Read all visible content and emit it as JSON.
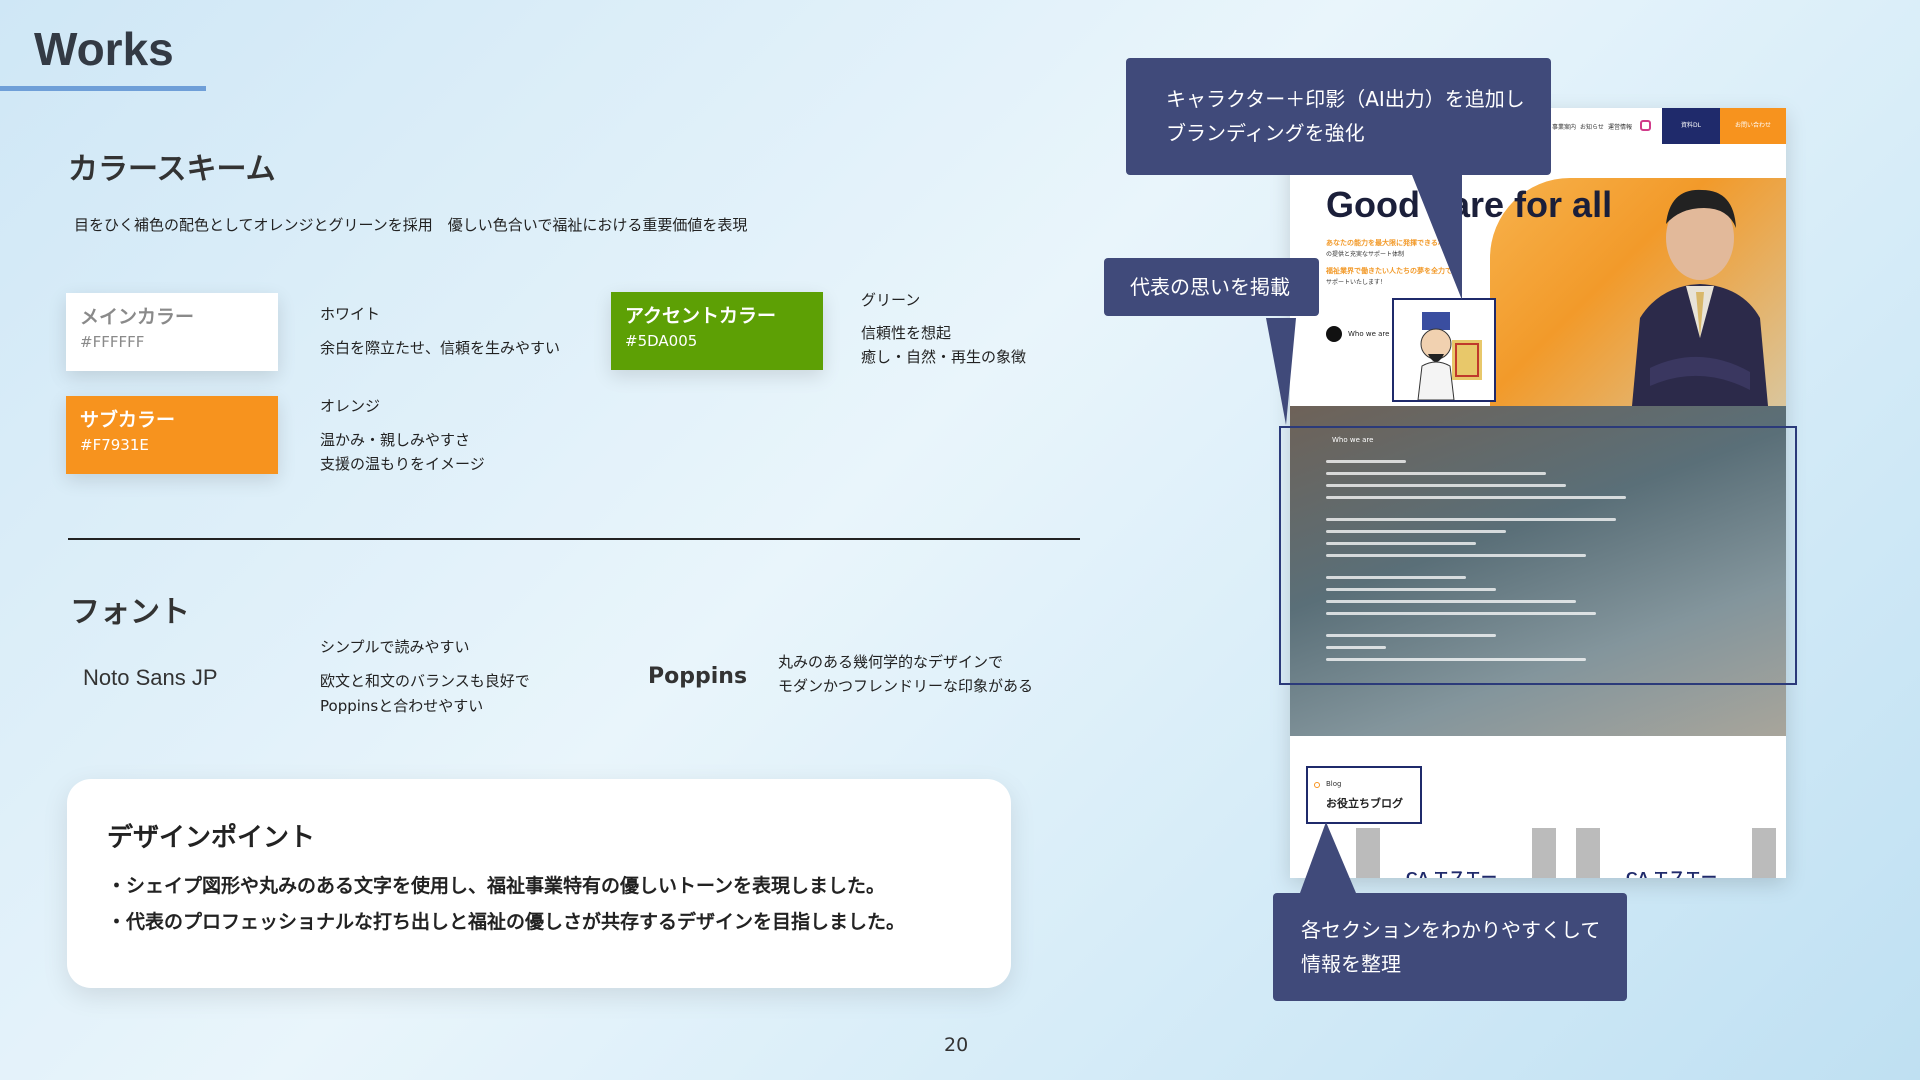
{
  "page": {
    "title": "Works",
    "page_number": "20"
  },
  "color_scheme": {
    "heading": "カラースキーム",
    "description": "目をひく補色の配色としてオレンジとグリーンを採用　優しい色合いで福祉における重要価値を表現",
    "main": {
      "name": "メインカラー",
      "hex": "#FFFFFF",
      "label": "ホワイト",
      "desc": "余白を際立たせ、信頼を生みやすい"
    },
    "sub": {
      "name": "サブカラー",
      "hex": "#F7931E",
      "label": "オレンジ",
      "desc1": "温かみ・親しみやすさ",
      "desc2": "支援の温もりをイメージ"
    },
    "accent": {
      "name": "アクセントカラー",
      "hex": "#5DA005",
      "label": "グリーン",
      "desc1": "信頼性を想起",
      "desc2": "癒し・自然・再生の象徴"
    }
  },
  "fonts": {
    "heading": "フォント",
    "noto": {
      "name": "Noto Sans JP",
      "desc1": "シンプルで読みやすい",
      "desc2": "欧文と和文のバランスも良好で",
      "desc3": "Poppinsと合わせやすい"
    },
    "poppins": {
      "name": "Poppins",
      "desc1": "丸みのある幾何学的なデザインで",
      "desc2": "モダンかつフレンドリーな印象がある"
    }
  },
  "design_point": {
    "heading": "デザインポイント",
    "line1": "・シェイプ図形や丸みのある文字を使用し、福祉事業特有の優しいトーンを表現しました。",
    "line2": "・代表のプロフェッショナルな打ち出しと福祉の優しさが共存するデザインを目指しました。"
  },
  "mockup": {
    "nav_items": [
      "事業案内",
      "お知らせ",
      "運営情報"
    ],
    "nav_btn_blue": "資料DL",
    "nav_btn_orange": "お問い合わせ",
    "headline": "Good care for all",
    "sub1": "あなたの能力を最大限に発揮できる場所",
    "sub2": "の提供と充実なサポート体制",
    "sub3": "福祉業界で働きたい人たちの夢を全力で",
    "sub4": "サポートいたします！",
    "who_link": "Who we are",
    "who_title": "Who we are",
    "blog_small": "Blog",
    "blog_title": "お役立ちブログ",
    "blog_logo": "CA エスエー"
  },
  "callouts": {
    "top_line1": "キャラクター＋印影（AI出力）を追加し",
    "top_line2": "ブランディングを強化",
    "left": "代表の思いを掲載",
    "bottom_line1": "各セクションをわかりやすくして",
    "bottom_line2": "情報を整理"
  },
  "colors": {
    "accent_blue": "#404A7A",
    "orange": "#F7931E",
    "green": "#5DA005"
  }
}
